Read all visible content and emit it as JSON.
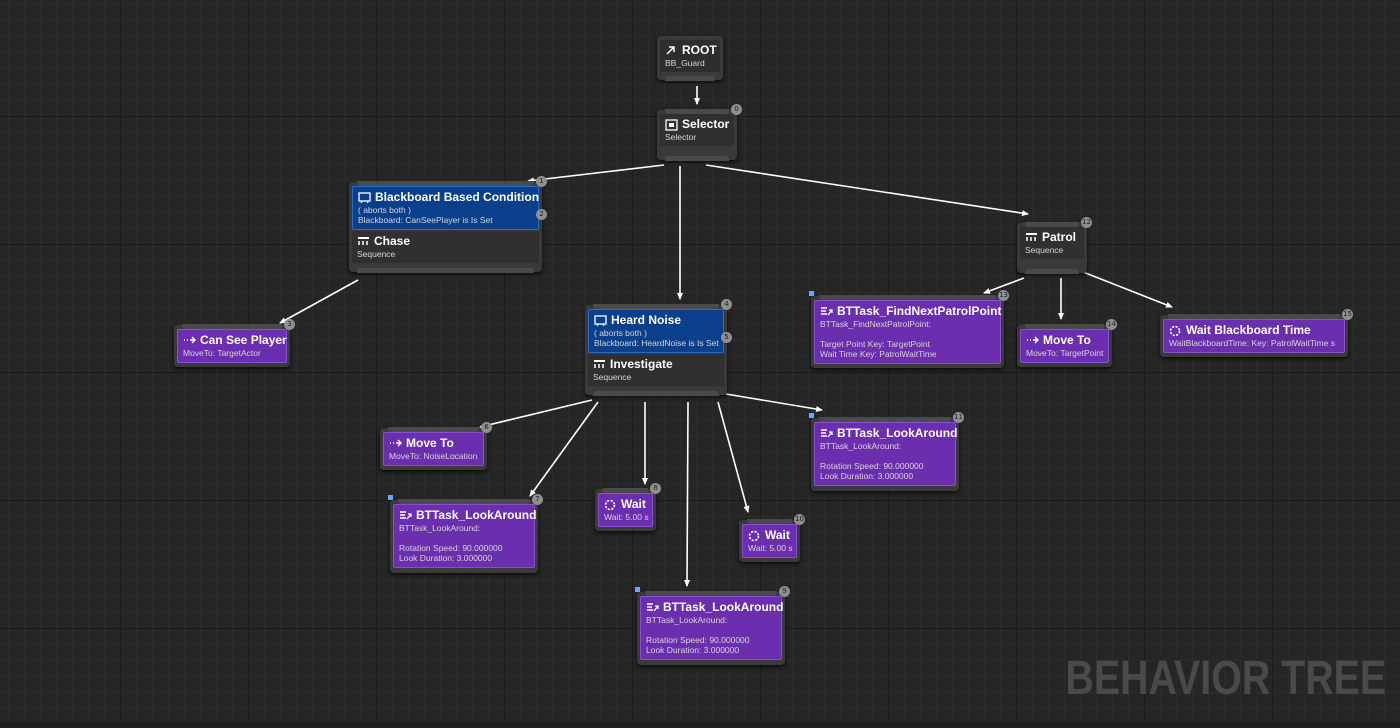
{
  "watermark": "BEHAVIOR TREE",
  "colors": {
    "composite": "#3a3a3a",
    "decorator": "#0a3f8c",
    "task": "#6a2eaf",
    "wire": "#ffffff"
  },
  "nodes": {
    "root": {
      "title": "ROOT",
      "sub": "BB_Guard",
      "icon": "root-icon"
    },
    "selector": {
      "title": "Selector",
      "sub": "Selector",
      "index": "0",
      "icon": "selector-icon"
    },
    "chase": {
      "index": "1",
      "decorator": {
        "title": "Blackboard Based Condition",
        "line1": "( aborts both )",
        "line2": "Blackboard: CanSeePlayer is Is Set",
        "index": "2",
        "icon": "decorator-icon"
      },
      "title": "Chase",
      "sub": "Sequence",
      "icon": "sequence-icon"
    },
    "can_see_player": {
      "title": "Can See Player",
      "sub": "MoveTo: TargetActor",
      "index": "3",
      "icon": "move-to-icon"
    },
    "investigate": {
      "index": "4",
      "decorator": {
        "title": "Heard Noise",
        "line1": "( aborts both )",
        "line2": "Blackboard: HeardNoise is Is Set",
        "index": "5",
        "icon": "decorator-icon"
      },
      "title": "Investigate",
      "sub": "Sequence",
      "icon": "sequence-icon"
    },
    "move_to_noise": {
      "title": "Move To",
      "sub": "MoveTo: NoiseLocation",
      "index": "6",
      "icon": "move-to-icon"
    },
    "lookaround_1": {
      "title": "BTTask_LookAround",
      "sub": "BTTask_LookAround:",
      "line1": "Rotation Speed: 90.000000",
      "line2": "Look Duration: 3.000000",
      "index": "7",
      "icon": "task-icon"
    },
    "wait_1": {
      "title": "Wait",
      "sub": "Wait: 5.00 s",
      "index": "8",
      "icon": "wait-icon"
    },
    "lookaround_2": {
      "title": "BTTask_LookAround",
      "sub": "BTTask_LookAround:",
      "line1": "Rotation Speed: 90.000000",
      "line2": "Look Duration: 3.000000",
      "index": "9",
      "icon": "task-icon"
    },
    "wait_2": {
      "title": "Wait",
      "sub": "Wait: 5.00 s",
      "index": "10",
      "icon": "wait-icon"
    },
    "lookaround_3": {
      "title": "BTTask_LookAround",
      "sub": "BTTask_LookAround:",
      "line1": "Rotation Speed: 90.000000",
      "line2": "Look Duration: 3.000000",
      "index": "11",
      "icon": "task-icon"
    },
    "patrol": {
      "title": "Patrol",
      "sub": "Sequence",
      "index": "12",
      "icon": "sequence-icon"
    },
    "find_patrol": {
      "title": "BTTask_FindNextPatrolPoint",
      "sub": "BTTask_FindNextPatrolPoint:",
      "line1": "Target Point Key: TargetPoint",
      "line2": "Wait Time Key: PatrolWaitTime",
      "index": "13",
      "icon": "task-icon"
    },
    "move_to_target": {
      "title": "Move To",
      "sub": "MoveTo: TargetPoint",
      "index": "14",
      "icon": "move-to-icon"
    },
    "wait_bb": {
      "title": "Wait Blackboard Time",
      "sub": "WaitBlackboardTime: Key: PatrolWaitTime s",
      "index": "15",
      "icon": "wait-icon"
    }
  }
}
